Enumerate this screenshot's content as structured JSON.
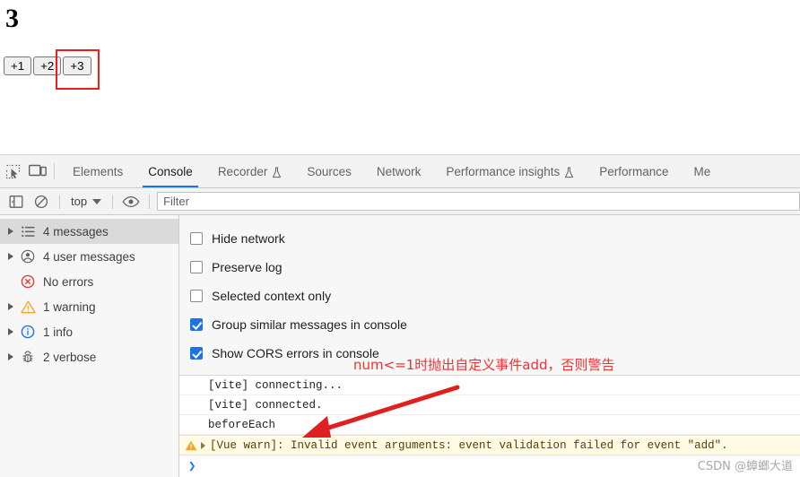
{
  "page": {
    "counter_value": "3",
    "buttons": [
      {
        "label": "+1"
      },
      {
        "label": "+2"
      },
      {
        "label": "+3"
      }
    ],
    "highlight_color": "#ee1c1c"
  },
  "devtools": {
    "tabs": [
      {
        "label": "Elements",
        "active": false,
        "flask": false
      },
      {
        "label": "Console",
        "active": true,
        "flask": false
      },
      {
        "label": "Recorder",
        "active": false,
        "flask": true
      },
      {
        "label": "Sources",
        "active": false,
        "flask": false
      },
      {
        "label": "Network",
        "active": false,
        "flask": false
      },
      {
        "label": "Performance insights",
        "active": false,
        "flask": true
      },
      {
        "label": "Performance",
        "active": false,
        "flask": false
      },
      {
        "label": "Me",
        "active": false,
        "flask": false
      }
    ],
    "accent_color": "#1a73e8",
    "filterbar": {
      "context_label": "top",
      "filter_placeholder": "Filter",
      "filter_value": ""
    },
    "sidebar": [
      {
        "label": "4 messages",
        "icon": "list-icon",
        "selected": true,
        "twisty": true
      },
      {
        "label": "4 user messages",
        "icon": "user-icon",
        "selected": false,
        "twisty": true
      },
      {
        "label": "No errors",
        "icon": "error-icon",
        "selected": false,
        "twisty": false
      },
      {
        "label": "1 warning",
        "icon": "warning-icon",
        "selected": false,
        "twisty": true
      },
      {
        "label": "1 info",
        "icon": "info-icon",
        "selected": false,
        "twisty": true
      },
      {
        "label": "2 verbose",
        "icon": "bug-icon",
        "selected": false,
        "twisty": true
      }
    ],
    "settings": [
      {
        "label": "Hide network",
        "checked": false
      },
      {
        "label": "Preserve log",
        "checked": false
      },
      {
        "label": "Selected context only",
        "checked": false
      },
      {
        "label": "Group similar messages in console",
        "checked": true
      },
      {
        "label": "Show CORS errors in console",
        "checked": true
      }
    ],
    "logs": [
      {
        "text": "[vite] connecting...",
        "level": "log"
      },
      {
        "text": "[vite] connected.",
        "level": "log"
      },
      {
        "text": "beforeEach",
        "level": "log"
      },
      {
        "text": "[Vue warn]: Invalid event arguments: event validation failed for event \"add\".",
        "level": "warning"
      }
    ],
    "prompt_symbol": "❯"
  },
  "annotations": {
    "note_text": "num<=1时抛出自定义事件add，否则警告",
    "note_color": "#f23030",
    "arrow_color": "#e02020"
  },
  "watermark": "CSDN @蟑螂大道"
}
